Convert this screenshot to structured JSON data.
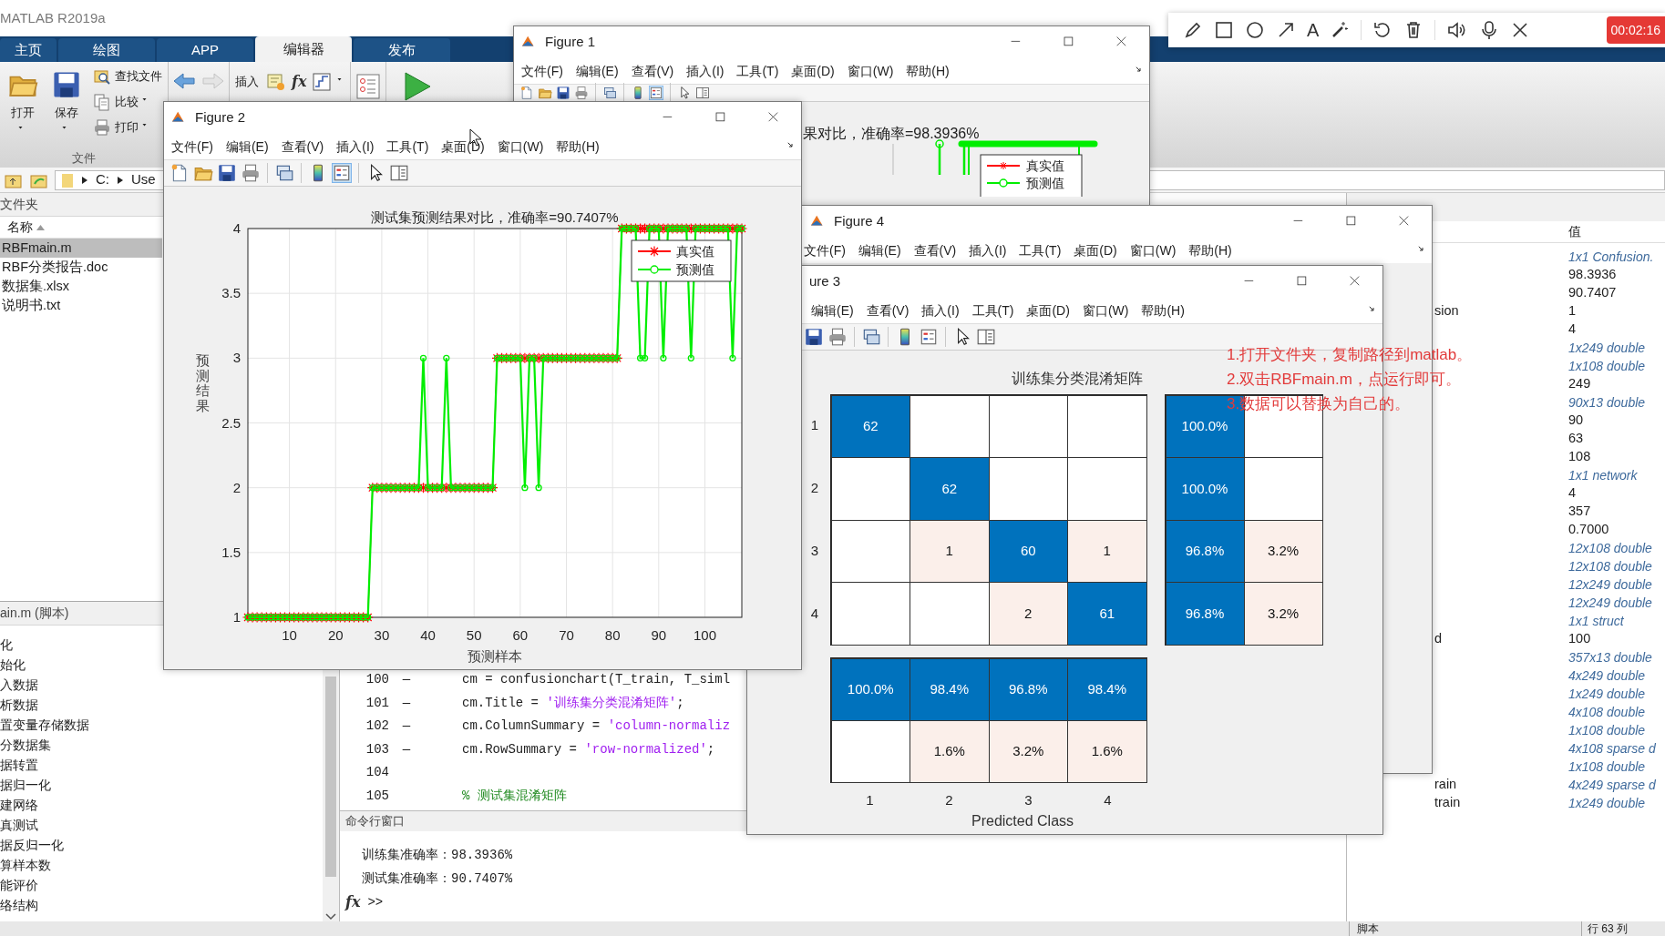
{
  "app": {
    "title": "MATLAB R2019a"
  },
  "ribbon_tabs": [
    {
      "label": "主页",
      "selected": false
    },
    {
      "label": "绘图",
      "selected": false
    },
    {
      "label": "APP",
      "selected": false
    },
    {
      "label": "编辑器",
      "selected": true
    },
    {
      "label": "发布",
      "selected": false
    }
  ],
  "ribbon": {
    "open": "打开",
    "save": "保存",
    "find_files": "查找文件",
    "compare": "比较",
    "print": "打印",
    "file_section": "文件",
    "insert": "插入",
    "fx": "fx"
  },
  "address_bar": {
    "parts": [
      "C:",
      "Use"
    ]
  },
  "file_browser": {
    "header": "文件夹",
    "column": "名称",
    "files": [
      {
        "name": "RBFmain.m",
        "selected": true
      },
      {
        "name": "RBF分类报告.doc",
        "selected": false
      },
      {
        "name": "数据集.xlsx",
        "selected": false
      },
      {
        "name": "说明书.txt",
        "selected": false
      }
    ]
  },
  "details": {
    "title": "ain.m  (脚本)",
    "items": [
      "化",
      "始化",
      "入数据",
      "析数据",
      "置变量存储数据",
      "分数据集",
      "据转置",
      "据归一化",
      "建网络",
      "真测试",
      "据反归一化",
      "算样本数",
      "能评价",
      "络结构"
    ]
  },
  "editor": {
    "lines": [
      {
        "number": "100",
        "marker": "—",
        "tokens": [
          {
            "kind": "code",
            "text": "cm = confusionchart(T_train, T_siml"
          }
        ]
      },
      {
        "number": "101",
        "marker": "—",
        "tokens": [
          {
            "kind": "code",
            "text": "cm.Title = "
          },
          {
            "kind": "string",
            "text": "'训练集分类混淆矩阵'"
          },
          {
            "kind": "code",
            "text": ";"
          }
        ]
      },
      {
        "number": "102",
        "marker": "—",
        "tokens": [
          {
            "kind": "code",
            "text": "cm.ColumnSummary = "
          },
          {
            "kind": "string",
            "text": "'column-normaliz"
          }
        ]
      },
      {
        "number": "103",
        "marker": "—",
        "tokens": [
          {
            "kind": "code",
            "text": "cm.RowSummary = "
          },
          {
            "kind": "string",
            "text": "'row-normalized'"
          },
          {
            "kind": "code",
            "text": ";"
          }
        ]
      },
      {
        "number": "104"
      },
      {
        "number": "105",
        "tokens": [
          {
            "kind": "comment",
            "text": "% 测试集混淆矩阵"
          }
        ]
      }
    ]
  },
  "command_window": {
    "title": "命令行窗口",
    "lines": [
      "训练集准确率：98.3936%",
      "测试集准确率：90.7407%"
    ],
    "fx": "fx",
    "prompt": ">>"
  },
  "workspace": {
    "value_header": "值",
    "rows": [
      {
        "value": "1x1 Confusion.",
        "kind": "class"
      },
      {
        "value": "98.3936",
        "kind": "value"
      },
      {
        "value": "90.7407",
        "kind": "value"
      },
      {
        "name": "sion",
        "value": "1",
        "kind": "value"
      },
      {
        "value": "4",
        "kind": "value"
      },
      {
        "value": "1x249 double",
        "kind": "class"
      },
      {
        "value": "1x108 double",
        "kind": "class"
      },
      {
        "value": "249",
        "kind": "value"
      },
      {
        "value": "90x13 double",
        "kind": "class"
      },
      {
        "value": "90",
        "kind": "value"
      },
      {
        "value": "63",
        "kind": "value"
      },
      {
        "value": "108",
        "kind": "value"
      },
      {
        "value": "1x1 network",
        "kind": "class"
      },
      {
        "value": "4",
        "kind": "value"
      },
      {
        "value": "357",
        "kind": "value"
      },
      {
        "value": "0.7000",
        "kind": "value"
      },
      {
        "value": "12x108 double",
        "kind": "class"
      },
      {
        "value": "12x108 double",
        "kind": "class"
      },
      {
        "value": "12x249 double",
        "kind": "class"
      },
      {
        "value": "12x249 double",
        "kind": "class"
      },
      {
        "value": "1x1 struct",
        "kind": "class"
      },
      {
        "name": "d",
        "value": "100",
        "kind": "value"
      },
      {
        "value": "357x13 double",
        "kind": "class"
      },
      {
        "value": "4x249 double",
        "kind": "class"
      },
      {
        "value": "1x249 double",
        "kind": "class"
      },
      {
        "value": "4x108 double",
        "kind": "class"
      },
      {
        "value": "1x108 double",
        "kind": "class"
      },
      {
        "value": "4x108 sparse d",
        "kind": "class"
      },
      {
        "value": "1x108 double",
        "kind": "class"
      },
      {
        "name": "rain",
        "value": "4x249 sparse d",
        "kind": "class"
      },
      {
        "name": "train",
        "value": "1x249 double",
        "kind": "class"
      }
    ]
  },
  "status_bar": [
    "脚本",
    "行 63 列"
  ],
  "recorder": {
    "text_tool": "A",
    "timer": "00:02:16"
  },
  "figure_1": {
    "title": "Figure 1",
    "menu": [
      "文件(F)",
      "编辑(E)",
      "查看(V)",
      "插入(I)",
      "工具(T)",
      "桌面(D)",
      "窗口(W)",
      "帮助(H)"
    ],
    "toolbar": {
      "legend_pressed": true
    },
    "chart_title": "果对比，准确率=98.3936%",
    "legend": [
      "真实值",
      "预测值"
    ]
  },
  "figure_4": {
    "title": "Figure 4",
    "menu": [
      "文件(F)",
      "编辑(E)",
      "查看(V)",
      "插入(I)",
      "工具(T)",
      "桌面(D)",
      "窗口(W)",
      "帮助(H)"
    ]
  },
  "figure_3": {
    "title": "ure 3",
    "menu": [
      "编辑(E)",
      "查看(V)",
      "插入(I)",
      "工具(T)",
      "桌面(D)",
      "窗口(W)",
      "帮助(H)"
    ],
    "toolbar": {
      "legend_pressed": false
    },
    "chart_title": "训练集分类混淆矩阵",
    "row_labels": [
      "1",
      "2",
      "3",
      "4"
    ],
    "matrix": [
      [
        {
          "text": "62",
          "kind": "diagonal"
        },
        {
          "kind": "empty"
        },
        {
          "kind": "empty"
        },
        {
          "kind": "empty"
        }
      ],
      [
        {
          "kind": "empty"
        },
        {
          "text": "62",
          "kind": "diagonal"
        },
        {
          "kind": "empty"
        },
        {
          "kind": "empty"
        }
      ],
      [
        {
          "kind": "empty"
        },
        {
          "text": "1",
          "kind": "error"
        },
        {
          "text": "60",
          "kind": "diagonal"
        },
        {
          "text": "1",
          "kind": "error"
        }
      ],
      [
        {
          "kind": "empty"
        },
        {
          "kind": "empty"
        },
        {
          "text": "2",
          "kind": "error"
        },
        {
          "text": "61",
          "kind": "diagonal"
        }
      ]
    ],
    "row_summary": [
      [
        {
          "text": "100.0%",
          "kind": "diagonal"
        },
        {
          "kind": "empty"
        }
      ],
      [
        {
          "text": "100.0%",
          "kind": "diagonal"
        },
        {
          "kind": "empty"
        }
      ],
      [
        {
          "text": "96.8%",
          "kind": "diagonal"
        },
        {
          "text": "3.2%",
          "kind": "error"
        }
      ],
      [
        {
          "text": "96.8%",
          "kind": "diagonal"
        },
        {
          "text": "3.2%",
          "kind": "error"
        }
      ]
    ],
    "column_summary": [
      [
        {
          "text": "100.0%",
          "kind": "diagonal"
        },
        {
          "text": "98.4%",
          "kind": "diagonal"
        },
        {
          "text": "96.8%",
          "kind": "diagonal"
        },
        {
          "text": "98.4%",
          "kind": "diagonal"
        }
      ],
      [
        {
          "kind": "empty"
        },
        {
          "text": "1.6%",
          "kind": "error"
        },
        {
          "text": "3.2%",
          "kind": "error"
        },
        {
          "text": "1.6%",
          "kind": "error"
        }
      ]
    ],
    "column_labels": [
      "1",
      "2",
      "3",
      "4"
    ],
    "xlabel": "Predicted Class"
  },
  "figure_2": {
    "title": "Figure 2",
    "menu": [
      "文件(F)",
      "编辑(E)",
      "查看(V)",
      "插入(I)",
      "工具(T)",
      "桌面(D)",
      "窗口(W)",
      "帮助(H)"
    ],
    "toolbar": {
      "legend_pressed": true
    },
    "chart_data": {
      "type": "line",
      "grid": true,
      "legend": true,
      "title": "测试集预测结果对比，准确率=90.7407%",
      "xlabel": "预测样本",
      "ylabel": "预测结果",
      "xlim": [
        1,
        108
      ],
      "ylim": [
        1,
        4
      ],
      "xticks": [
        10,
        20,
        30,
        40,
        50,
        60,
        70,
        80,
        90,
        100
      ],
      "yticks": [
        1,
        1.5,
        2,
        2.5,
        3,
        3.5,
        4
      ],
      "x": [
        1,
        2,
        3,
        4,
        5,
        6,
        7,
        8,
        9,
        10,
        11,
        12,
        13,
        14,
        15,
        16,
        17,
        18,
        19,
        20,
        21,
        22,
        23,
        24,
        25,
        26,
        27,
        28,
        29,
        30,
        31,
        32,
        33,
        34,
        35,
        36,
        37,
        38,
        39,
        40,
        41,
        42,
        43,
        44,
        45,
        46,
        47,
        48,
        49,
        50,
        51,
        52,
        53,
        54,
        55,
        56,
        57,
        58,
        59,
        60,
        61,
        62,
        63,
        64,
        65,
        66,
        67,
        68,
        69,
        70,
        71,
        72,
        73,
        74,
        75,
        76,
        77,
        78,
        79,
        80,
        81,
        82,
        83,
        84,
        85,
        86,
        87,
        88,
        89,
        90,
        91,
        92,
        93,
        94,
        95,
        96,
        97,
        98,
        99,
        100,
        101,
        102,
        103,
        104,
        105,
        106,
        107,
        108
      ],
      "series": [
        {
          "name": "真实值",
          "color": "#ff0000",
          "marker": "cross",
          "values": [
            1,
            1,
            1,
            1,
            1,
            1,
            1,
            1,
            1,
            1,
            1,
            1,
            1,
            1,
            1,
            1,
            1,
            1,
            1,
            1,
            1,
            1,
            1,
            1,
            1,
            1,
            1,
            2,
            2,
            2,
            2,
            2,
            2,
            2,
            2,
            2,
            2,
            2,
            2,
            2,
            2,
            2,
            2,
            2,
            2,
            2,
            2,
            2,
            2,
            2,
            2,
            2,
            2,
            2,
            3,
            3,
            3,
            3,
            3,
            3,
            3,
            3,
            3,
            3,
            3,
            3,
            3,
            3,
            3,
            3,
            3,
            3,
            3,
            3,
            3,
            3,
            3,
            3,
            3,
            3,
            3,
            4,
            4,
            4,
            4,
            4,
            4,
            4,
            4,
            4,
            4,
            4,
            4,
            4,
            4,
            4,
            4,
            4,
            4,
            4,
            4,
            4,
            4,
            4,
            4,
            4,
            4,
            4
          ]
        },
        {
          "name": "预测值",
          "color": "#00ee00",
          "marker": "circle",
          "values": [
            1,
            1,
            1,
            1,
            1,
            1,
            1,
            1,
            1,
            1,
            1,
            1,
            1,
            1,
            1,
            1,
            1,
            1,
            1,
            1,
            1,
            1,
            1,
            1,
            1,
            1,
            1,
            2,
            2,
            2,
            2,
            2,
            2,
            2,
            2,
            2,
            2,
            2,
            3,
            2,
            2,
            2,
            2,
            3,
            2,
            2,
            2,
            2,
            2,
            2,
            2,
            2,
            2,
            2,
            3,
            3,
            3,
            3,
            3,
            3,
            2,
            3,
            3,
            2,
            3,
            3,
            3,
            3,
            3,
            3,
            3,
            3,
            3,
            3,
            3,
            3,
            3,
            3,
            3,
            3,
            3,
            4,
            4,
            4,
            4,
            3,
            3,
            4,
            4,
            4,
            3,
            4,
            4,
            4,
            4,
            4,
            3,
            4,
            4,
            4,
            4,
            4,
            4,
            4,
            4,
            3,
            4,
            4
          ]
        }
      ]
    }
  },
  "note": [
    "1.打开文件夹，复制路径到matlab。",
    "2.双击RBFmain.m，点运行即可。",
    "3.数据可以替换为自己的。"
  ]
}
